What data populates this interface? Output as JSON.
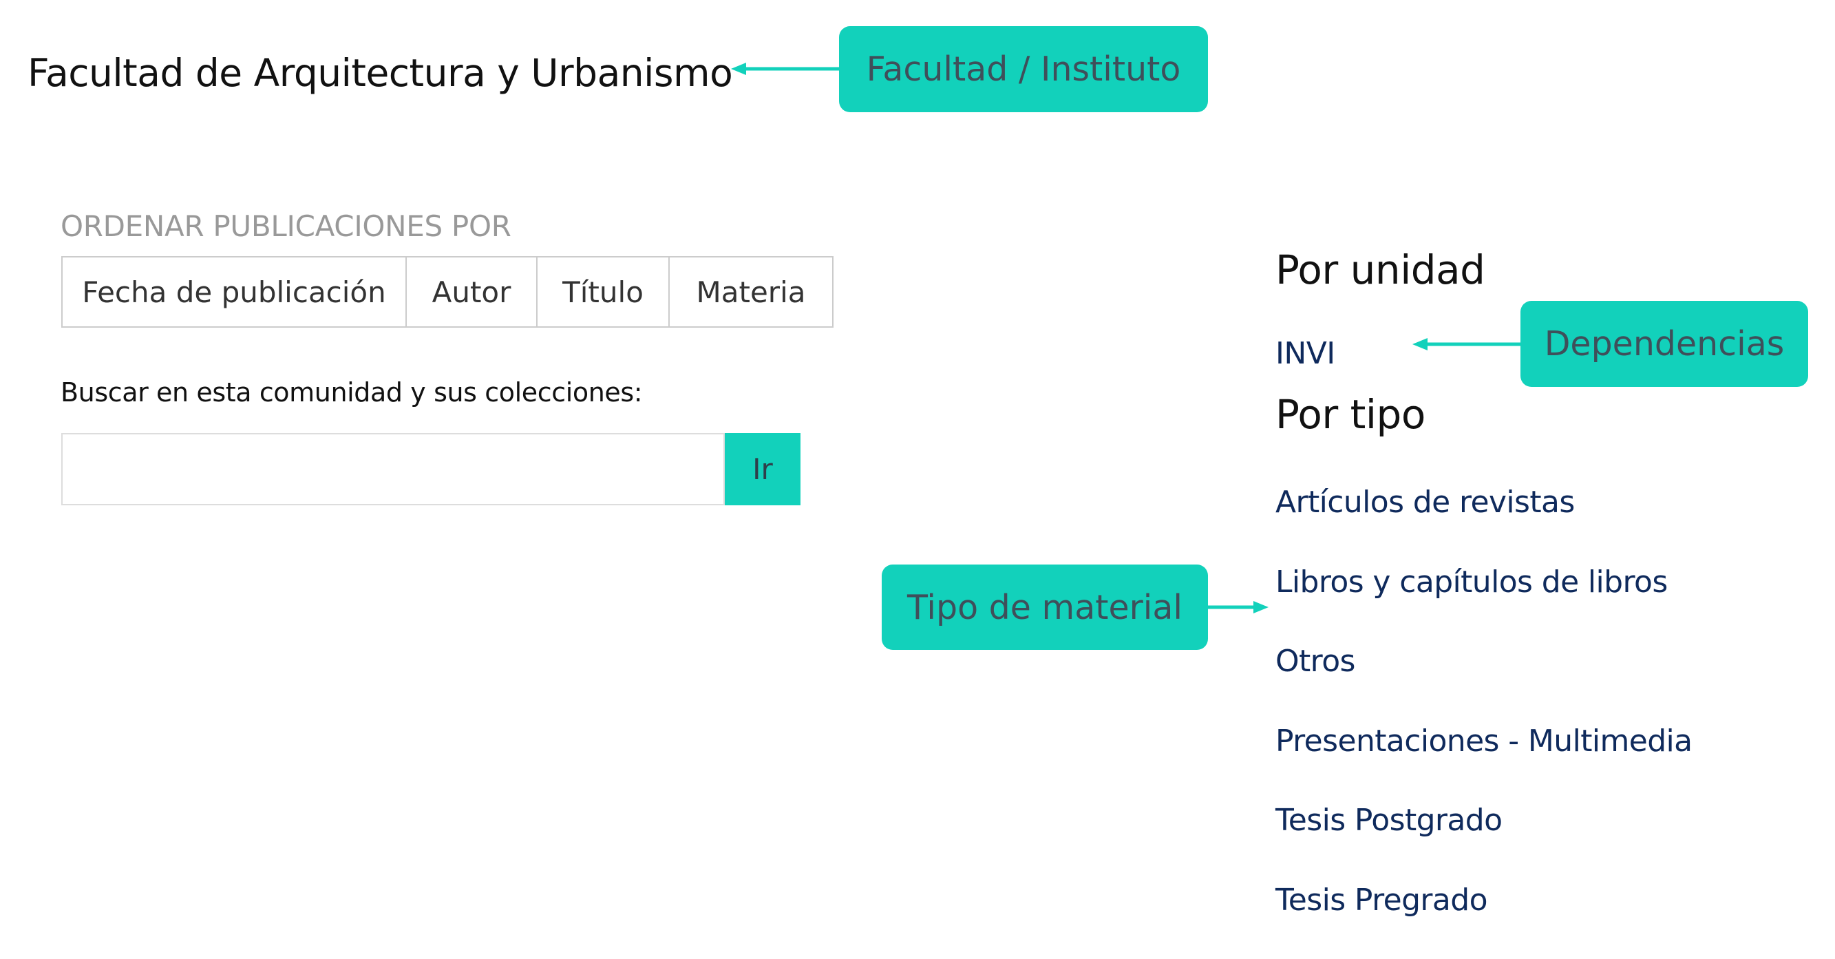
{
  "page": {
    "title": "Facultad de Arquitectura y Urbanismo"
  },
  "callouts": {
    "facultad": "Facultad / Instituto",
    "dependencias": "Dependencias",
    "tipo": "Tipo de material",
    "color": "#12d1bb"
  },
  "sort": {
    "heading": "ORDENAR PUBLICACIONES POR",
    "options": [
      "Fecha de publicación",
      "Autor",
      "Título",
      "Materia"
    ]
  },
  "search": {
    "label": "Buscar en esta comunidad y sus colecciones:",
    "value": "",
    "button_label": "Ir"
  },
  "by_unit": {
    "heading": "Por unidad",
    "links": [
      "INVI"
    ]
  },
  "by_type": {
    "heading": "Por tipo",
    "links": [
      "Artículos de revistas",
      "Libros y capítulos de libros",
      "Otros",
      "Presentaciones - Multimedia",
      "Tesis Postgrado",
      "Tesis Pregrado"
    ]
  },
  "colors": {
    "accent": "#12d1bb",
    "link": "#0f2a5c",
    "muted": "#999999"
  }
}
